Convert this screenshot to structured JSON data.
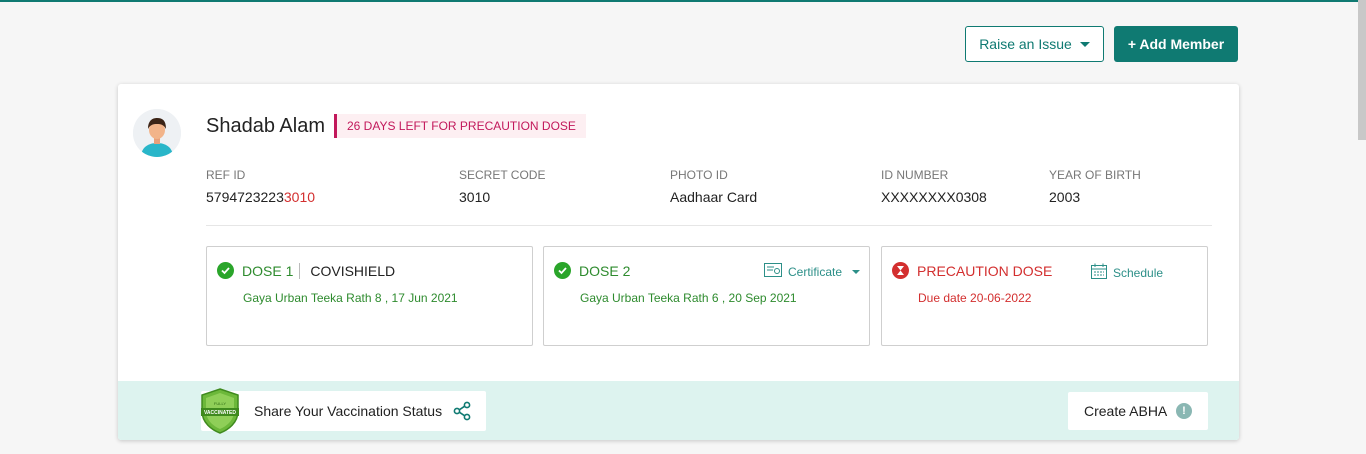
{
  "header": {
    "raise_issue_label": "Raise an Issue",
    "add_member_label": "+ Add Member"
  },
  "member": {
    "name": "Shadab Alam",
    "precaution_notice": "26 DAYS LEFT FOR PRECAUTION DOSE",
    "fields": {
      "ref_id": {
        "label": "REF ID",
        "value_main": "5794723223",
        "value_highlight": "3010"
      },
      "secret_code": {
        "label": "SECRET CODE",
        "value": "3010"
      },
      "photo_id": {
        "label": "PHOTO ID",
        "value": "Aadhaar Card"
      },
      "id_number": {
        "label": "ID NUMBER",
        "value": "XXXXXXXX0308"
      },
      "year_of_birth": {
        "label": "YEAR OF BIRTH",
        "value": "2003"
      }
    }
  },
  "doses": [
    {
      "title": "DOSE 1",
      "vaccine": "COVISHIELD",
      "detail": "Gaya Urban Teeka Rath 8 , 17 Jun 2021",
      "status": "completed"
    },
    {
      "title": "DOSE 2",
      "detail": "Gaya Urban Teeka Rath 6 , 20 Sep 2021",
      "action_label": "Certificate",
      "status": "completed"
    },
    {
      "title": "PRECAUTION DOSE",
      "detail": "Due date 20-06-2022",
      "action_label": "Schedule",
      "status": "due"
    }
  ],
  "footer": {
    "share_label": "Share Your Vaccination Status",
    "badge_text_top": "FULLY",
    "badge_text_main": "VACCINATED",
    "abha_label": "Create ABHA",
    "abha_info": "!"
  },
  "colors": {
    "brand_teal": "#0f7a72",
    "success_green": "#2e8b2e",
    "alert_red": "#d32f2f",
    "notice_pink": "#c2185b",
    "footer_bg": "#ddf3ef"
  },
  "icons": {
    "avatar": "avatar-icon",
    "dose_complete": "check-circle-icon",
    "dose_due": "hourglass-icon",
    "certificate": "certificate-icon",
    "schedule": "calendar-icon",
    "share": "share-icon",
    "badge": "vaccinated-badge-icon",
    "info": "info-icon"
  }
}
